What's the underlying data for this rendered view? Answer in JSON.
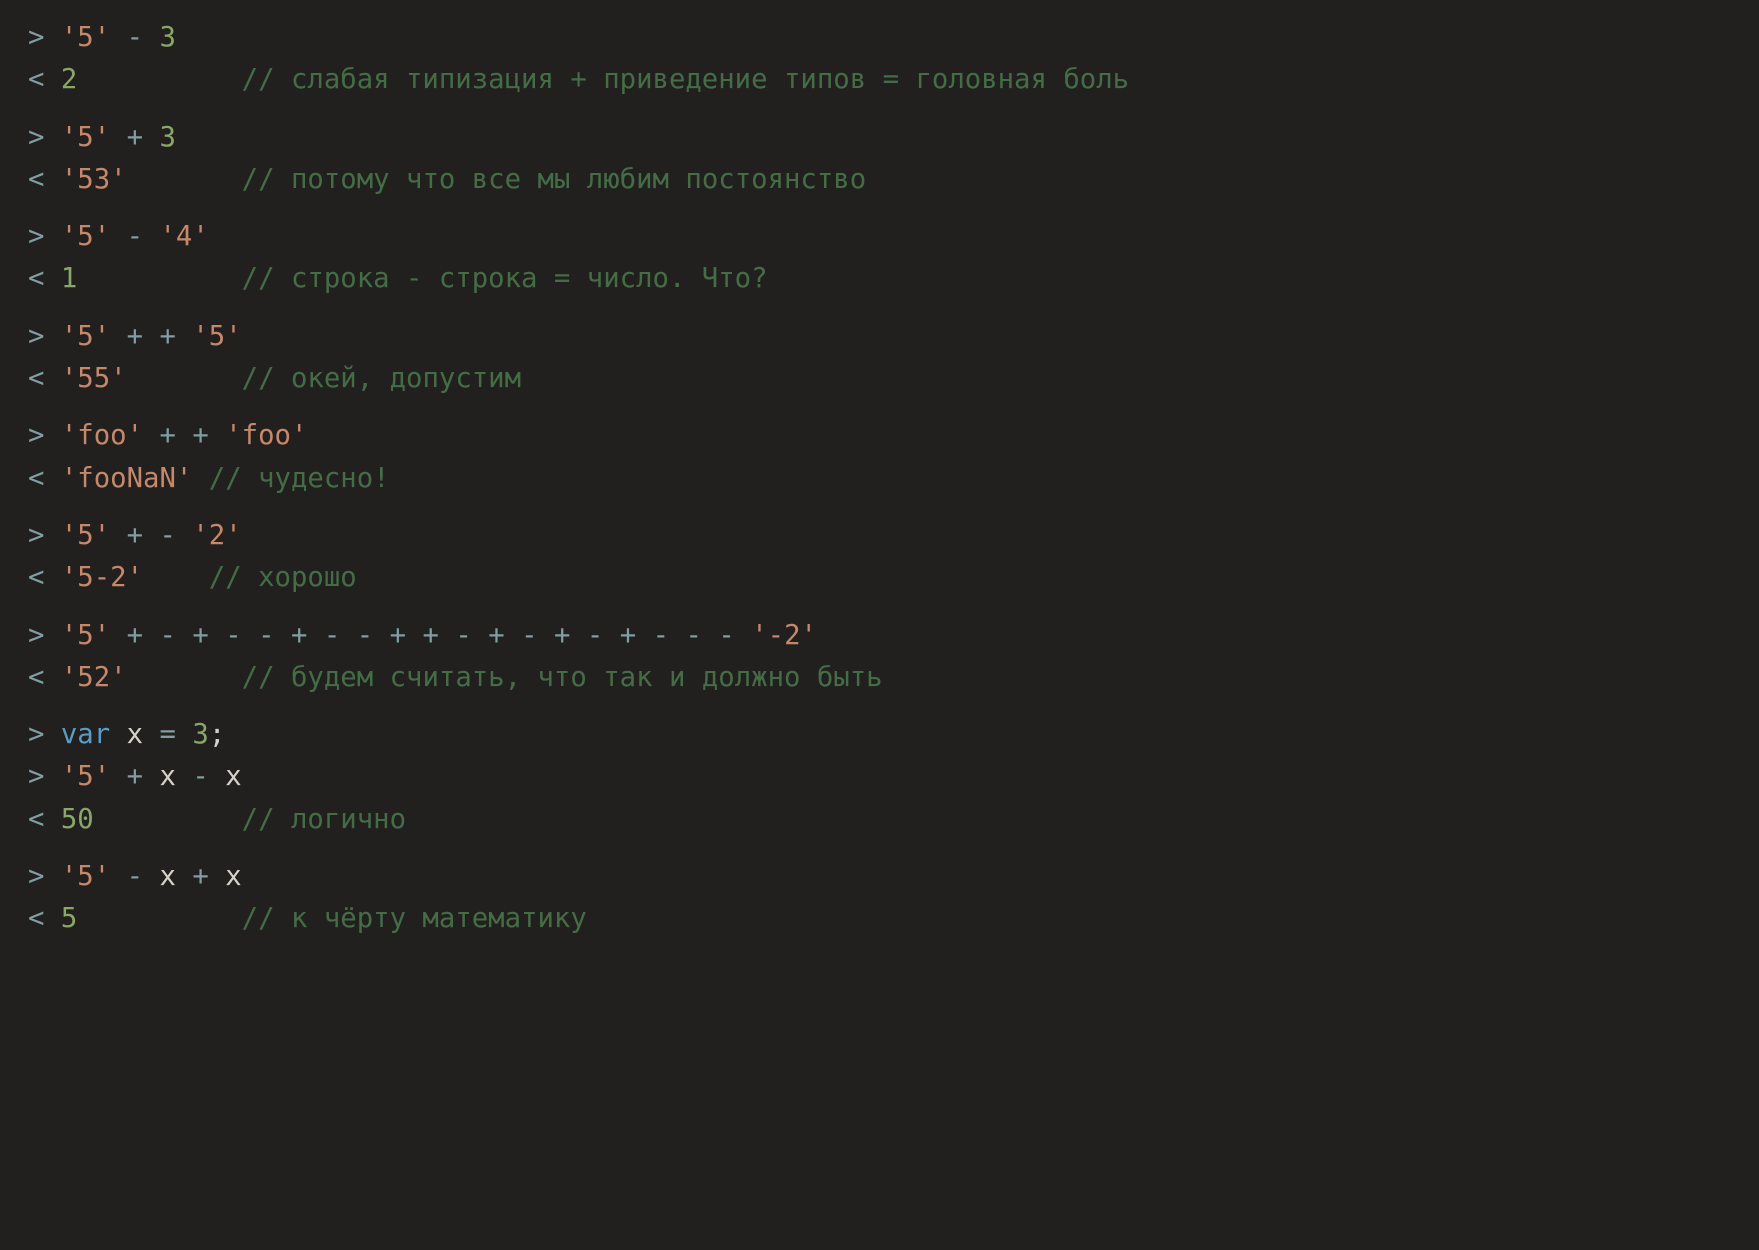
{
  "prompts": {
    "in": ">",
    "out": "<"
  },
  "groups": [
    {
      "lines": [
        {
          "dir": "in",
          "tokens": [
            {
              "t": "str",
              "v": "'5'"
            },
            {
              "t": "sp",
              "v": " "
            },
            {
              "t": "op",
              "v": "-"
            },
            {
              "t": "sp",
              "v": " "
            },
            {
              "t": "num",
              "v": "3"
            }
          ]
        },
        {
          "dir": "out",
          "tokens": [
            {
              "t": "num",
              "v": "2"
            }
          ],
          "comment": "// слабая типизация + приведение типов = головная боль"
        }
      ]
    },
    {
      "lines": [
        {
          "dir": "in",
          "tokens": [
            {
              "t": "str",
              "v": "'5'"
            },
            {
              "t": "sp",
              "v": " "
            },
            {
              "t": "op",
              "v": "+"
            },
            {
              "t": "sp",
              "v": " "
            },
            {
              "t": "num",
              "v": "3"
            }
          ]
        },
        {
          "dir": "out",
          "tokens": [
            {
              "t": "str",
              "v": "'53'"
            }
          ],
          "comment": "// потому что все мы любим постоянство"
        }
      ]
    },
    {
      "lines": [
        {
          "dir": "in",
          "tokens": [
            {
              "t": "str",
              "v": "'5'"
            },
            {
              "t": "sp",
              "v": " "
            },
            {
              "t": "op",
              "v": "-"
            },
            {
              "t": "sp",
              "v": " "
            },
            {
              "t": "str",
              "v": "'4'"
            }
          ]
        },
        {
          "dir": "out",
          "tokens": [
            {
              "t": "num",
              "v": "1"
            }
          ],
          "comment": "// строка - строка = число. Что?"
        }
      ]
    },
    {
      "lines": [
        {
          "dir": "in",
          "tokens": [
            {
              "t": "str",
              "v": "'5'"
            },
            {
              "t": "sp",
              "v": " "
            },
            {
              "t": "op",
              "v": "+"
            },
            {
              "t": "sp",
              "v": " "
            },
            {
              "t": "op",
              "v": "+"
            },
            {
              "t": "sp",
              "v": " "
            },
            {
              "t": "str",
              "v": "'5'"
            }
          ]
        },
        {
          "dir": "out",
          "tokens": [
            {
              "t": "str",
              "v": "'55'"
            }
          ],
          "comment": "// окей, допустим"
        }
      ]
    },
    {
      "lines": [
        {
          "dir": "in",
          "tokens": [
            {
              "t": "str",
              "v": "'foo'"
            },
            {
              "t": "sp",
              "v": " "
            },
            {
              "t": "op",
              "v": "+"
            },
            {
              "t": "sp",
              "v": " "
            },
            {
              "t": "op",
              "v": "+"
            },
            {
              "t": "sp",
              "v": " "
            },
            {
              "t": "str",
              "v": "'foo'"
            }
          ]
        },
        {
          "dir": "out",
          "tokens": [
            {
              "t": "str",
              "v": "'fooNaN'"
            }
          ],
          "comment": "// чудесно!",
          "comment_col": 11
        }
      ]
    },
    {
      "lines": [
        {
          "dir": "in",
          "tokens": [
            {
              "t": "str",
              "v": "'5'"
            },
            {
              "t": "sp",
              "v": " "
            },
            {
              "t": "op",
              "v": "+"
            },
            {
              "t": "sp",
              "v": " "
            },
            {
              "t": "op",
              "v": "-"
            },
            {
              "t": "sp",
              "v": " "
            },
            {
              "t": "str",
              "v": "'2'"
            }
          ]
        },
        {
          "dir": "out",
          "tokens": [
            {
              "t": "str",
              "v": "'5-2'"
            }
          ],
          "comment": "// хорошо",
          "comment_col": 11
        }
      ]
    },
    {
      "lines": [
        {
          "dir": "in",
          "tokens": [
            {
              "t": "str",
              "v": "'5'"
            },
            {
              "t": "sp",
              "v": " "
            },
            {
              "t": "op",
              "v": "+"
            },
            {
              "t": "sp",
              "v": " "
            },
            {
              "t": "op",
              "v": "-"
            },
            {
              "t": "sp",
              "v": " "
            },
            {
              "t": "op",
              "v": "+"
            },
            {
              "t": "sp",
              "v": " "
            },
            {
              "t": "op",
              "v": "-"
            },
            {
              "t": "sp",
              "v": " "
            },
            {
              "t": "op",
              "v": "-"
            },
            {
              "t": "sp",
              "v": " "
            },
            {
              "t": "op",
              "v": "+"
            },
            {
              "t": "sp",
              "v": " "
            },
            {
              "t": "op",
              "v": "-"
            },
            {
              "t": "sp",
              "v": " "
            },
            {
              "t": "op",
              "v": "-"
            },
            {
              "t": "sp",
              "v": " "
            },
            {
              "t": "op",
              "v": "+"
            },
            {
              "t": "sp",
              "v": " "
            },
            {
              "t": "op",
              "v": "+"
            },
            {
              "t": "sp",
              "v": " "
            },
            {
              "t": "op",
              "v": "-"
            },
            {
              "t": "sp",
              "v": " "
            },
            {
              "t": "op",
              "v": "+"
            },
            {
              "t": "sp",
              "v": " "
            },
            {
              "t": "op",
              "v": "-"
            },
            {
              "t": "sp",
              "v": " "
            },
            {
              "t": "op",
              "v": "+"
            },
            {
              "t": "sp",
              "v": " "
            },
            {
              "t": "op",
              "v": "-"
            },
            {
              "t": "sp",
              "v": " "
            },
            {
              "t": "op",
              "v": "+"
            },
            {
              "t": "sp",
              "v": " "
            },
            {
              "t": "op",
              "v": "-"
            },
            {
              "t": "sp",
              "v": " "
            },
            {
              "t": "op",
              "v": "-"
            },
            {
              "t": "sp",
              "v": " "
            },
            {
              "t": "op",
              "v": "-"
            },
            {
              "t": "sp",
              "v": " "
            },
            {
              "t": "str",
              "v": "'-2'"
            }
          ]
        },
        {
          "dir": "out",
          "tokens": [
            {
              "t": "str",
              "v": "'52'"
            }
          ],
          "comment": "// будем считать, что так и должно быть"
        }
      ]
    },
    {
      "lines": [
        {
          "dir": "in",
          "tokens": [
            {
              "t": "kw",
              "v": "var"
            },
            {
              "t": "sp",
              "v": " "
            },
            {
              "t": "ident",
              "v": "x"
            },
            {
              "t": "sp",
              "v": " "
            },
            {
              "t": "op",
              "v": "="
            },
            {
              "t": "sp",
              "v": " "
            },
            {
              "t": "num",
              "v": "3"
            },
            {
              "t": "punct",
              "v": ";"
            }
          ]
        },
        {
          "dir": "in",
          "tokens": [
            {
              "t": "str",
              "v": "'5'"
            },
            {
              "t": "sp",
              "v": " "
            },
            {
              "t": "op",
              "v": "+"
            },
            {
              "t": "sp",
              "v": " "
            },
            {
              "t": "ident",
              "v": "x"
            },
            {
              "t": "sp",
              "v": " "
            },
            {
              "t": "op",
              "v": "-"
            },
            {
              "t": "sp",
              "v": " "
            },
            {
              "t": "ident",
              "v": "x"
            }
          ]
        },
        {
          "dir": "out",
          "tokens": [
            {
              "t": "num",
              "v": "50"
            }
          ],
          "comment": "// логично"
        }
      ]
    },
    {
      "lines": [
        {
          "dir": "in",
          "tokens": [
            {
              "t": "str",
              "v": "'5'"
            },
            {
              "t": "sp",
              "v": " "
            },
            {
              "t": "op",
              "v": "-"
            },
            {
              "t": "sp",
              "v": " "
            },
            {
              "t": "ident",
              "v": "x"
            },
            {
              "t": "sp",
              "v": " "
            },
            {
              "t": "op",
              "v": "+"
            },
            {
              "t": "sp",
              "v": " "
            },
            {
              "t": "ident",
              "v": "x"
            }
          ]
        },
        {
          "dir": "out",
          "tokens": [
            {
              "t": "num",
              "v": "5"
            }
          ],
          "comment": "// к чёрту математику"
        }
      ]
    }
  ],
  "comment_default_col": 13
}
